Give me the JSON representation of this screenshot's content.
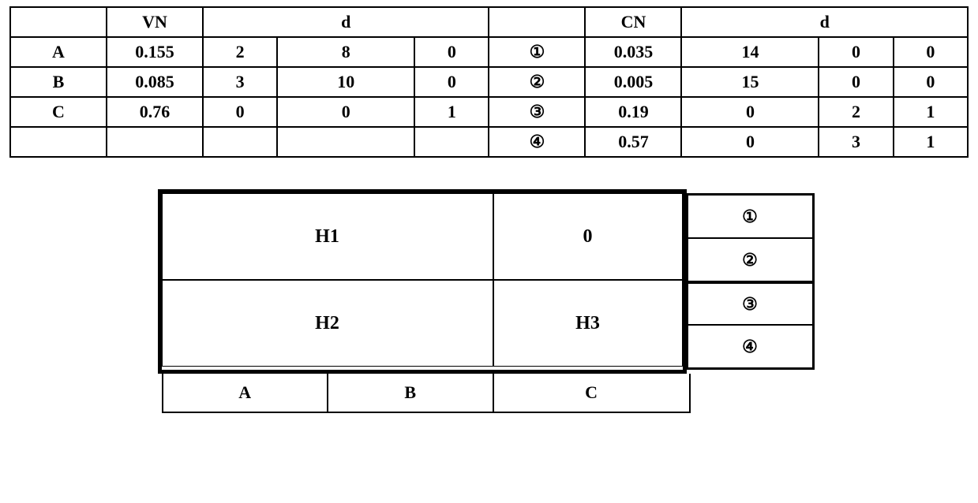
{
  "table": {
    "headers": {
      "left_blank": "",
      "vn": "VN",
      "d_left": "d",
      "mid_blank": "",
      "cn": "CN",
      "d_right": "d"
    },
    "left_rows": [
      {
        "label": "A",
        "vn": "0.155",
        "d": [
          "2",
          "8",
          "0"
        ]
      },
      {
        "label": "B",
        "vn": "0.085",
        "d": [
          "3",
          "10",
          "0"
        ]
      },
      {
        "label": "C",
        "vn": "0.76",
        "d": [
          "0",
          "0",
          "1"
        ]
      },
      {
        "label": "",
        "vn": "",
        "d": [
          "",
          "",
          ""
        ]
      }
    ],
    "right_rows": [
      {
        "label": "①",
        "cn": "0.035",
        "d": [
          "14",
          "0",
          "0"
        ]
      },
      {
        "label": "②",
        "cn": "0.005",
        "d": [
          "15",
          "0",
          "0"
        ]
      },
      {
        "label": "③",
        "cn": "0.19",
        "d": [
          "0",
          "2",
          "1"
        ]
      },
      {
        "label": "④",
        "cn": "0.57",
        "d": [
          "0",
          "3",
          "1"
        ]
      }
    ]
  },
  "diagram": {
    "h_cells": {
      "h1": "H1",
      "zero": "0",
      "h2": "H2",
      "h3": "H3"
    },
    "side": {
      "s1": "①",
      "s2": "②",
      "s3": "③",
      "s4": "④"
    },
    "bottom": {
      "a": "A",
      "b": "B",
      "c": "C"
    }
  }
}
